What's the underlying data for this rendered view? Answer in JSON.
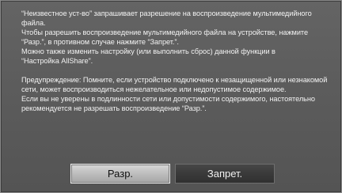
{
  "dialog": {
    "paragraph1": "“Неизвестное уст-во” запрашивает разрешение на воспроизведение мультимедийного\nфайла.\nЧтобы разрешить воспроизведение мультимедийного файла на устройстве, нажмите\n“Разр.”, в противном случае нажмите “Запрет.”.\nМожно также изменить настройку (или выполнить сброс) данной функции в\n“Настройка AllShare”.",
    "paragraph2": "Предупреждение: Помните, если устройство подключено к незащищенной или незнакомой\nсети, может воспроизводиться нежелательное или недопустимое содержимое.\nЕсли вы не уверены в подлинности сети или допустимости содержимого, настоятельно\nрекомендуется не разрешать воспроизведение “Разр.”."
  },
  "buttons": {
    "allow_label": "Разр.",
    "deny_label": "Запрет."
  },
  "colors": {
    "dialog_bg": "#5e5e5e",
    "text": "#f2f2f2",
    "allow_bg": "#c0c0c0",
    "deny_bg": "#3a3a3a"
  }
}
